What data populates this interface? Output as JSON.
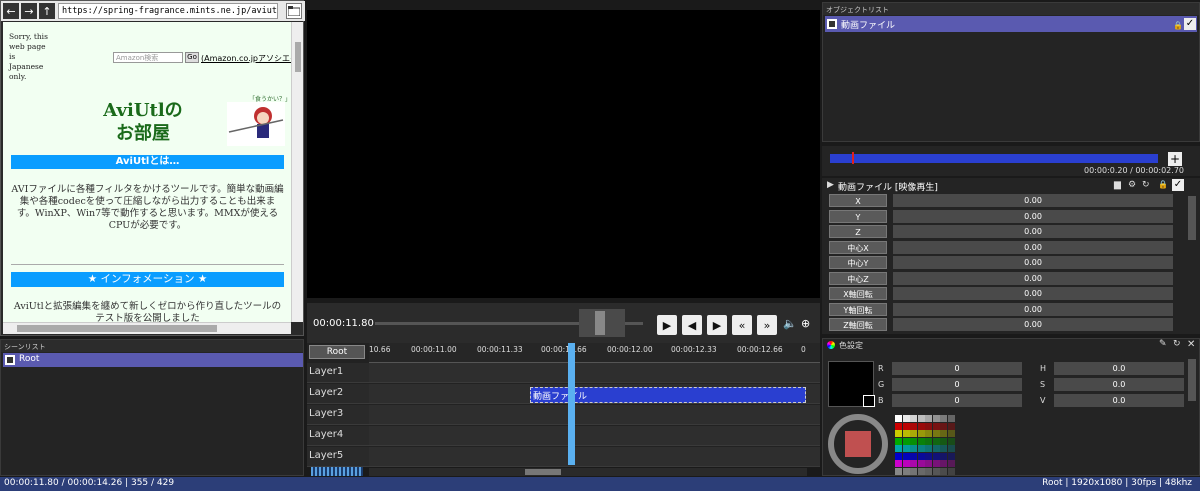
{
  "browser": {
    "url": "https://spring-fragrance.mints.ne.jp/aviutl/",
    "sorry_text": "Sorry, this web page is Japanese only.",
    "search_placeholder": "Amazon検索",
    "go_label": "Go",
    "amazon_link": "(Amazon.co.jpアソシエイト)",
    "site_title_1": "AviUtlの",
    "site_title_2": "お部屋",
    "mascot_caption": "「食うかい？」",
    "section1_title": "AviUtlとは…",
    "section1_body": "AVIファイルに各種フィルタをかけるツールです。簡単な動画編集や各種codecを使って圧縮しながら出力することも出来ます。WinXP、Win7等で動作すると思います。MMXが使えるCPUが必要です。",
    "section2_title": "★ インフォメーション ★",
    "section2_body": "AviUtlと拡張編集を纏めて新しくゼロから作り直したツールのテスト版を公開しました"
  },
  "transport": {
    "time": "00:00:11.80"
  },
  "scenes": {
    "header": "シーンリスト",
    "items": [
      "Root"
    ]
  },
  "timeline": {
    "root_button": "Root",
    "ticks": [
      "10.66",
      "00:00:11.00",
      "00:00:11.33",
      "00:00:11.66",
      "00:00:12.00",
      "00:00:12.33",
      "00:00:12.66",
      "0"
    ],
    "layers": [
      "Layer1",
      "Layer2",
      "Layer3",
      "Layer4",
      "Layer5"
    ],
    "clip_label": "動画ファイル"
  },
  "objects": {
    "header": "オブジェクトリスト",
    "items": [
      "動画ファイル"
    ]
  },
  "playback": {
    "time": "00:00:0.20 / 00:00:02.70"
  },
  "props": {
    "title": "動画ファイル [映像再生]",
    "rows": [
      {
        "label": "X",
        "value": "0.00"
      },
      {
        "label": "Y",
        "value": "0.00"
      },
      {
        "label": "Z",
        "value": "0.00"
      },
      {
        "label": "中心X",
        "value": "0.00"
      },
      {
        "label": "中心Y",
        "value": "0.00"
      },
      {
        "label": "中心Z",
        "value": "0.00"
      },
      {
        "label": "X軸回転",
        "value": "0.00"
      },
      {
        "label": "Y軸回転",
        "value": "0.00"
      },
      {
        "label": "Z軸回転",
        "value": "0.00"
      }
    ]
  },
  "color": {
    "title": "色設定",
    "rgb": [
      {
        "label": "R",
        "value": "0"
      },
      {
        "label": "G",
        "value": "0"
      },
      {
        "label": "B",
        "value": "0"
      }
    ],
    "hsv": [
      {
        "label": "H",
        "value": "0.0"
      },
      {
        "label": "S",
        "value": "0.0"
      },
      {
        "label": "V",
        "value": "0.0"
      }
    ]
  },
  "status": {
    "left": "00:00:11.80 / 00:00:14.26  |  355 / 429",
    "right": "Root  |  1920x1080  |  30fps  |  48khz"
  },
  "colors": {
    "accent": "#2a3fd0",
    "playhead": "#5ab0f0",
    "status_bg": "#2c3e78"
  }
}
